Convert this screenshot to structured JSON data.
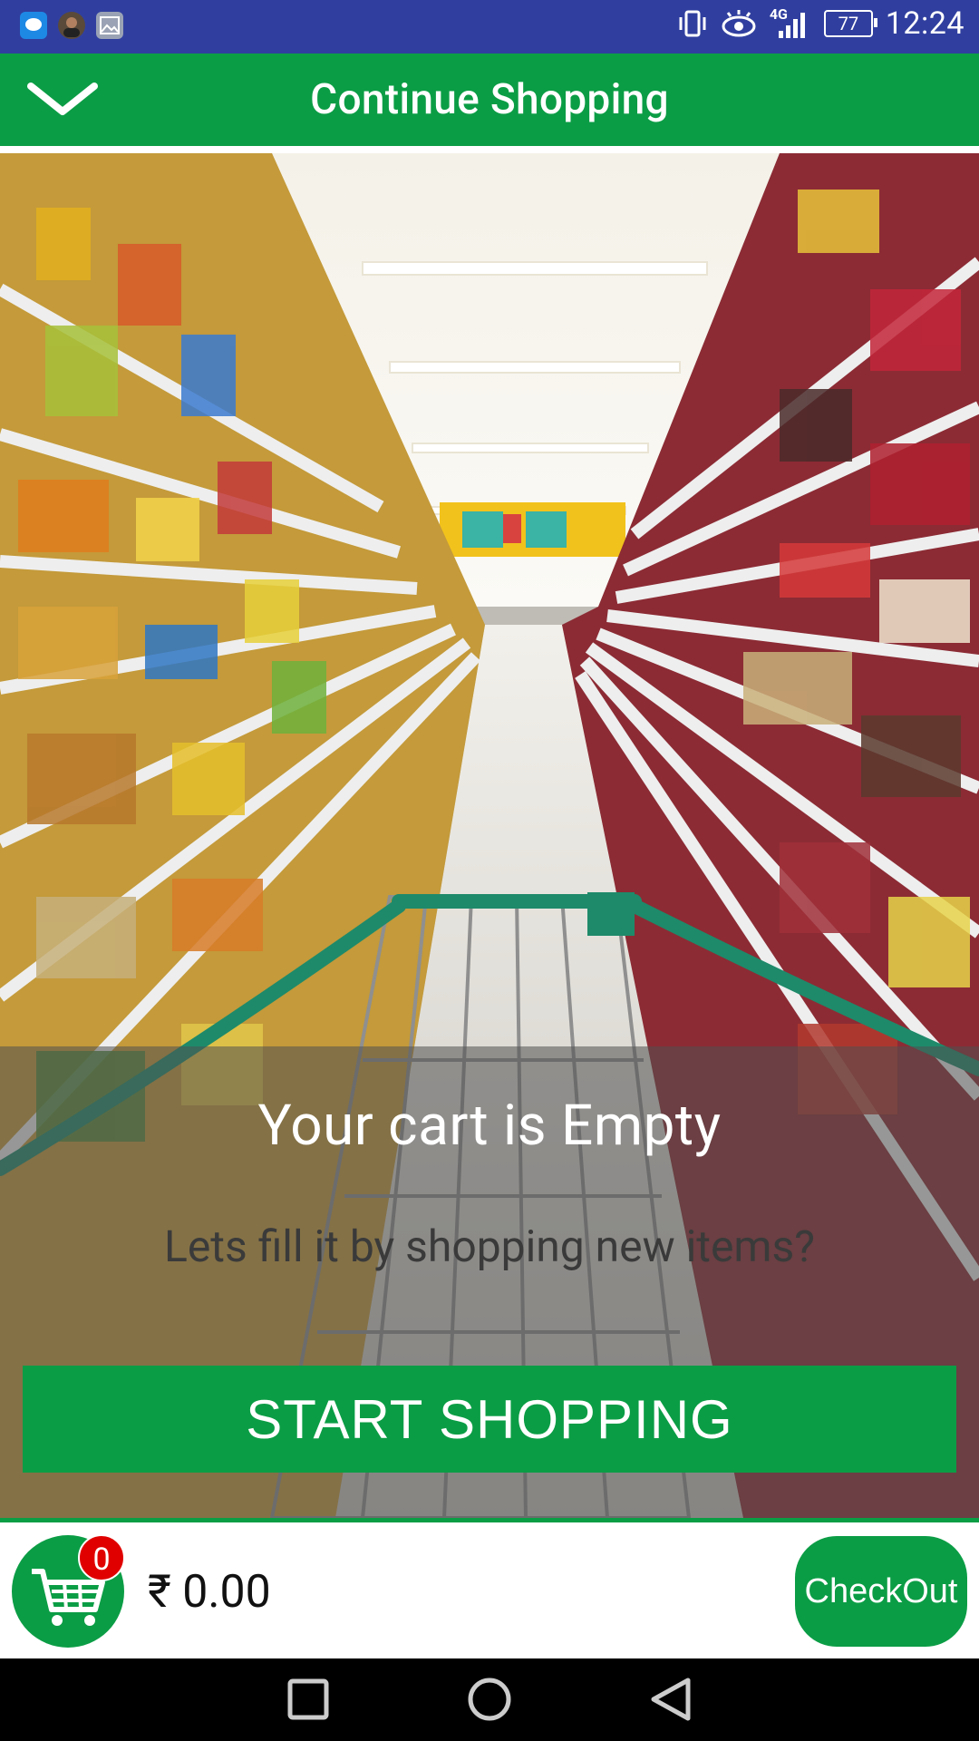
{
  "status_bar": {
    "time": "12:24",
    "battery": "77",
    "network": "4G",
    "icons": [
      "messages-icon",
      "profile-photo-icon",
      "gallery-icon",
      "vibrate-icon",
      "eye-comfort-icon",
      "signal-icon",
      "battery-icon"
    ]
  },
  "header": {
    "title": "Continue Shopping",
    "back_icon": "chevron-down-icon"
  },
  "empty_state": {
    "title": "Your cart is Empty",
    "subtitle": "Lets fill it by shopping new items?",
    "button_label": "START SHOPPING"
  },
  "bottom_bar": {
    "cart_count": "0",
    "total": "₹ 0.00",
    "checkout_label": "CheckOut"
  },
  "colors": {
    "status_bar": "#303f9f",
    "brand_green": "#0b9d45",
    "badge_red": "#e00000"
  },
  "nav_icons": [
    "recents-square-icon",
    "home-circle-icon",
    "back-triangle-icon"
  ]
}
